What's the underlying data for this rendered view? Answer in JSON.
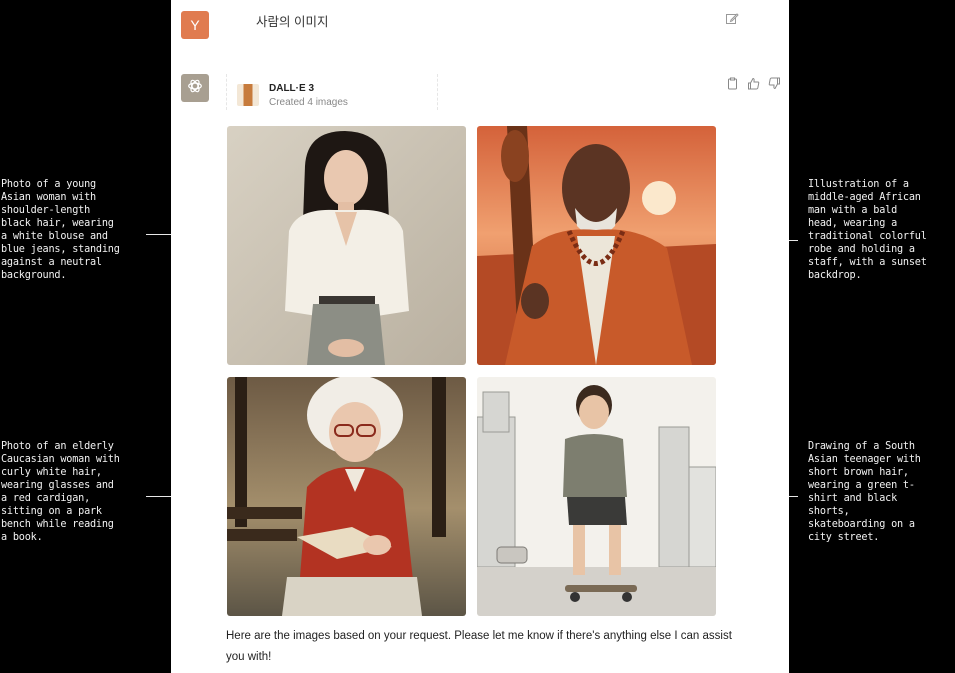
{
  "annotations": {
    "left_top": "Photo of a young\nAsian woman with\nshoulder-length\nblack hair, wearing\na white blouse and\nblue jeans, standing\nagainst a neutral\nbackground.",
    "right_top": "Illustration of a\nmiddle-aged African\nman with a bald\nhead, wearing a\ntraditional colorful\nrobe and holding a\nstaff, with a sunset\nbackdrop.",
    "left_bottom": "Photo of an elderly\nCaucasian woman with\ncurly white hair,\nwearing glasses and\na red cardigan,\nsitting on a park\nbench while reading\na book.",
    "right_bottom": "Drawing of a South\nAsian teenager with\nshort brown hair,\nwearing a green t-\nshirt and black\nshorts,\nskateboarding on a\ncity street."
  },
  "user": {
    "initial": "Y",
    "message": "사람의 이미지"
  },
  "tool": {
    "name": "DALL·E 3",
    "status": "Created 4 images"
  },
  "icons": {
    "edit": "edit-icon",
    "gpt": "openai-logo-icon",
    "copy": "clipboard-icon",
    "like": "thumbs-up-icon",
    "dislike": "thumbs-down-icon"
  },
  "reply": "Here are the images based on your request. Please let me know if there's anything else I can assist you with!"
}
